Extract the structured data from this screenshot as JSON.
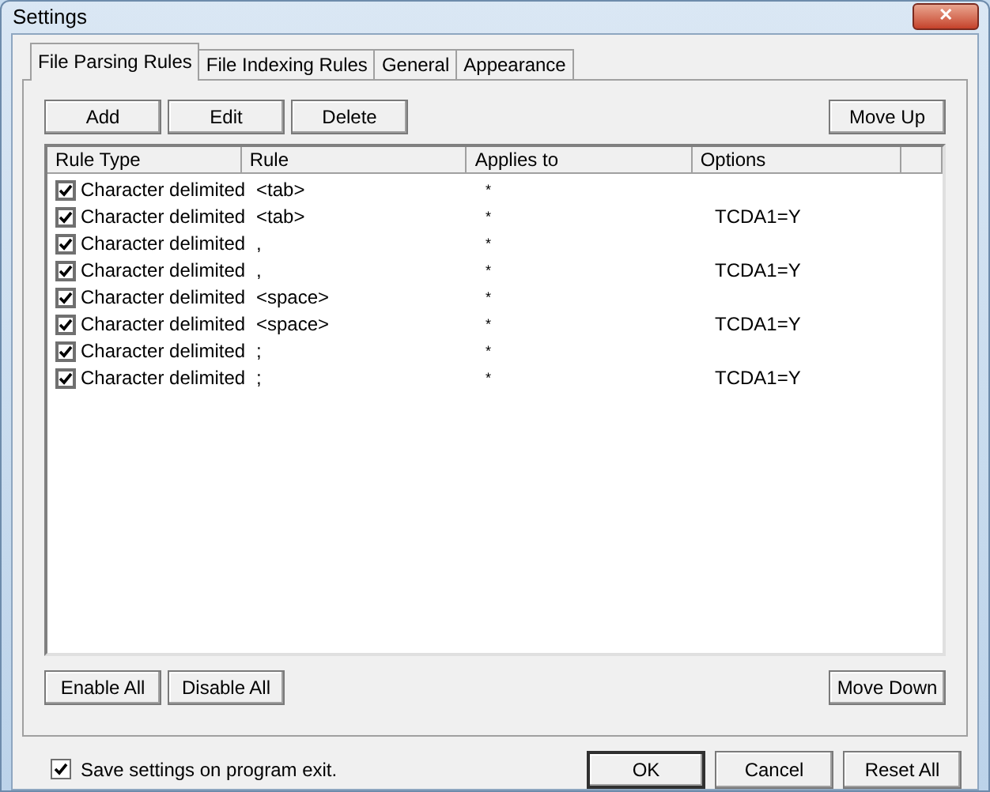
{
  "window": {
    "title": "Settings",
    "close": "✕"
  },
  "tabs": [
    {
      "label": "File Parsing Rules",
      "selected": true
    },
    {
      "label": "File Indexing Rules",
      "selected": false
    },
    {
      "label": "General",
      "selected": false
    },
    {
      "label": "Appearance",
      "selected": false
    }
  ],
  "top_buttons": [
    "Add",
    "Edit",
    "Delete"
  ],
  "move_up": "Move Up",
  "table": {
    "columns": [
      "Rule Type",
      "Rule",
      "Applies to",
      "Options"
    ],
    "rows": [
      {
        "checked": true,
        "rule_type": "Character delimited",
        "rule": "<tab>",
        "applies_to": "*",
        "options": ""
      },
      {
        "checked": true,
        "rule_type": "Character delimited",
        "rule": "<tab>",
        "applies_to": "*",
        "options": "TCDA1=Y"
      },
      {
        "checked": true,
        "rule_type": "Character delimited",
        "rule": ",",
        "applies_to": "*",
        "options": ""
      },
      {
        "checked": true,
        "rule_type": "Character delimited",
        "rule": ",",
        "applies_to": "*",
        "options": "TCDA1=Y"
      },
      {
        "checked": true,
        "rule_type": "Character delimited",
        "rule": "<space>",
        "applies_to": "*",
        "options": ""
      },
      {
        "checked": true,
        "rule_type": "Character delimited",
        "rule": "<space>",
        "applies_to": "*",
        "options": "TCDA1=Y"
      },
      {
        "checked": true,
        "rule_type": "Character delimited",
        "rule": ";",
        "applies_to": "*",
        "options": ""
      },
      {
        "checked": true,
        "rule_type": "Character delimited",
        "rule": ";",
        "applies_to": "*",
        "options": "TCDA1=Y"
      }
    ]
  },
  "bottom_buttons": [
    "Enable All",
    "Disable All"
  ],
  "move_down": "Move Down",
  "save_on_exit": {
    "label": "Save settings on program exit.",
    "checked": true
  },
  "dialog_buttons": [
    {
      "label": "OK",
      "default": true
    },
    {
      "label": "Cancel",
      "default": false
    },
    {
      "label": "Reset All",
      "default": false
    }
  ]
}
